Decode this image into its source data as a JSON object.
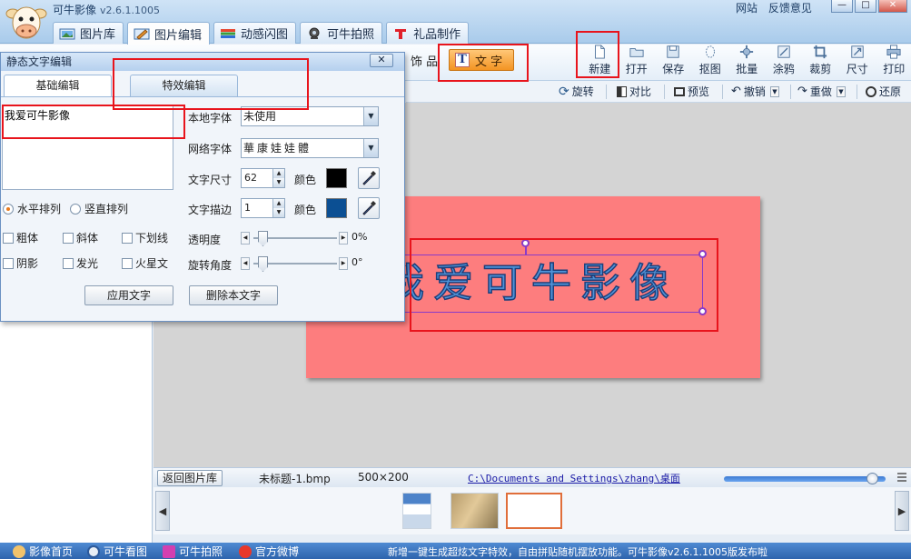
{
  "app": {
    "title": "可牛影像",
    "version": "v2.6.1.1005",
    "links": [
      "网站",
      "反馈意见"
    ],
    "window_buttons": [
      "—",
      "□",
      "✕"
    ]
  },
  "main_tabs": [
    {
      "label": "图片库",
      "icon": "photo-library-icon",
      "active": false
    },
    {
      "label": "图片编辑",
      "icon": "image-edit-icon",
      "active": true
    },
    {
      "label": "动感闪图",
      "icon": "animation-icon",
      "active": false
    },
    {
      "label": "可牛拍照",
      "icon": "webcam-icon",
      "active": false
    },
    {
      "label": "礼品制作",
      "icon": "gift-icon",
      "active": false
    }
  ],
  "toolbar": {
    "decoration_label": "饰 品",
    "text_tool_label": "文 字",
    "tools": [
      {
        "label": "新建",
        "icon": "new-file-icon"
      },
      {
        "label": "打开",
        "icon": "open-folder-icon"
      },
      {
        "label": "保存",
        "icon": "save-icon"
      },
      {
        "label": "抠图",
        "icon": "cutout-icon"
      },
      {
        "label": "批量",
        "icon": "batch-icon"
      },
      {
        "label": "涂鸦",
        "icon": "doodle-icon"
      },
      {
        "label": "裁剪",
        "icon": "crop-icon"
      },
      {
        "label": "尺寸",
        "icon": "resize-icon"
      },
      {
        "label": "打印",
        "icon": "print-icon"
      }
    ]
  },
  "toolbar2": {
    "rotate": "旋转",
    "compare": "对比",
    "preview": "预览",
    "undo": "撤销",
    "redo": "重做",
    "restore": "还原"
  },
  "dialog": {
    "title": "静态文字编辑",
    "close_label": "✕",
    "tabs": [
      "基础编辑",
      "特效编辑"
    ],
    "text_value": "我爱可牛影像",
    "orientation": {
      "horizontal": "水平排列",
      "vertical": "竖直排列",
      "selected": "horizontal"
    },
    "styles": [
      "粗体",
      "斜体",
      "下划线",
      "阴影",
      "发光",
      "火星文"
    ],
    "local_font_label": "本地字体",
    "local_font_value": "未使用",
    "web_font_label": "网络字体",
    "web_font_value": "華康娃娃體",
    "size_label": "文字尺寸",
    "size_value": "62",
    "stroke_label": "文字描边",
    "stroke_value": "1",
    "color_label": "颜色",
    "text_color": "#000000",
    "stroke_color": "#0b4f93",
    "opacity_label": "透明度",
    "opacity_value": "0%",
    "rotation_label": "旋转角度",
    "rotation_value": "0°",
    "apply_button": "应用文字",
    "delete_button": "删除本文字"
  },
  "canvas": {
    "background_color": "#fd7d7e",
    "art_text": "我爱可牛影像",
    "art_text_color": "#4f93d8"
  },
  "status": {
    "back_button": "返回图片库",
    "file_name": "未标题-1.bmp",
    "image_size": "500×200",
    "path": "C:\\Documents and Settings\\zhang\\桌面",
    "zoom_level": 0.95
  },
  "bottom_bar": {
    "items": [
      {
        "label": "影像首页",
        "icon": "home-icon"
      },
      {
        "label": "可牛看图",
        "icon": "viewer-icon"
      },
      {
        "label": "可牛拍照",
        "icon": "camera-icon"
      },
      {
        "label": "官方微博",
        "icon": "weibo-icon"
      }
    ],
    "news": "新增一键生成超炫文字特效，自由拼贴随机摆放功能。可牛影像v2.6.1.1005版发布啦"
  }
}
